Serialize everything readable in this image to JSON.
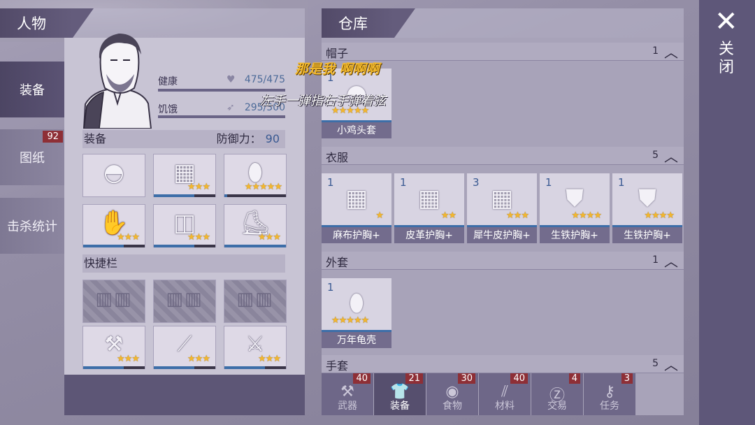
{
  "character": {
    "header": "人物",
    "stats": [
      {
        "label": "健康",
        "value": "475/475"
      },
      {
        "label": "饥饿",
        "value": "295/300"
      }
    ],
    "equipment_label": "装备",
    "defense_label": "防御力：",
    "defense_value": "90",
    "quickbar_label": "快捷栏",
    "equipment_slots": [
      {
        "icon": "hat-icon",
        "stars": ""
      },
      {
        "icon": "vest-icon",
        "stars": "★★★"
      },
      {
        "icon": "shell-icon",
        "stars": "★★★★★"
      },
      {
        "icon": "gloves-icon",
        "stars": "★★★"
      },
      {
        "icon": "pants-icon",
        "stars": "★★★"
      },
      {
        "icon": "shoes-icon",
        "stars": "★★★"
      }
    ],
    "quick_slots": [
      {
        "icon": "axe-icon",
        "stars": "★★★"
      },
      {
        "icon": "spear-icon",
        "stars": "★★★"
      },
      {
        "icon": "machete-icon",
        "stars": "★★★"
      }
    ]
  },
  "nav": [
    {
      "label": "装备",
      "active": true
    },
    {
      "label": "图纸",
      "badge": "92"
    },
    {
      "label": "击杀统计"
    }
  ],
  "warehouse": {
    "header": "仓库",
    "sections": [
      {
        "label": "帽子",
        "count": "1",
        "items": [
          {
            "qty": "1",
            "name": "小鸡头套",
            "stars": "★★★★★"
          }
        ]
      },
      {
        "label": "衣服",
        "count": "5",
        "items": [
          {
            "qty": "1",
            "name": "麻布护胸+",
            "stars": "★"
          },
          {
            "qty": "1",
            "name": "皮革护胸+",
            "stars": "★★"
          },
          {
            "qty": "3",
            "name": "犀牛皮护胸+",
            "stars": "★★★"
          },
          {
            "qty": "1",
            "name": "生铁护胸+",
            "stars": "★★★★"
          },
          {
            "qty": "1",
            "name": "生铁护胸+",
            "stars": "★★★★"
          }
        ]
      },
      {
        "label": "外套",
        "count": "1",
        "items": [
          {
            "qty": "1",
            "name": "万年龟壳",
            "stars": "★★★★★"
          }
        ]
      },
      {
        "label": "手套",
        "count": "5",
        "items": []
      }
    ]
  },
  "tabs": [
    {
      "label": "武器",
      "badge": "40",
      "icon": "axe-icon"
    },
    {
      "label": "装备",
      "badge": "21",
      "icon": "shirt-icon",
      "active": true
    },
    {
      "label": "食物",
      "badge": "30",
      "icon": "meat-icon"
    },
    {
      "label": "材料",
      "badge": "40",
      "icon": "wood-icon"
    },
    {
      "label": "交易",
      "badge": "4",
      "icon": "coin-icon"
    },
    {
      "label": "任务",
      "badge": "3",
      "icon": "key-icon"
    }
  ],
  "close": {
    "label": "关闭"
  },
  "overlay": {
    "line1": "那是我 啊啊啊",
    "line2": "左手一弹指右手弹着弦"
  },
  "colors": {
    "accent": "#3d6ea8",
    "star": "#f4b72d",
    "badge": "#8e2f36"
  }
}
